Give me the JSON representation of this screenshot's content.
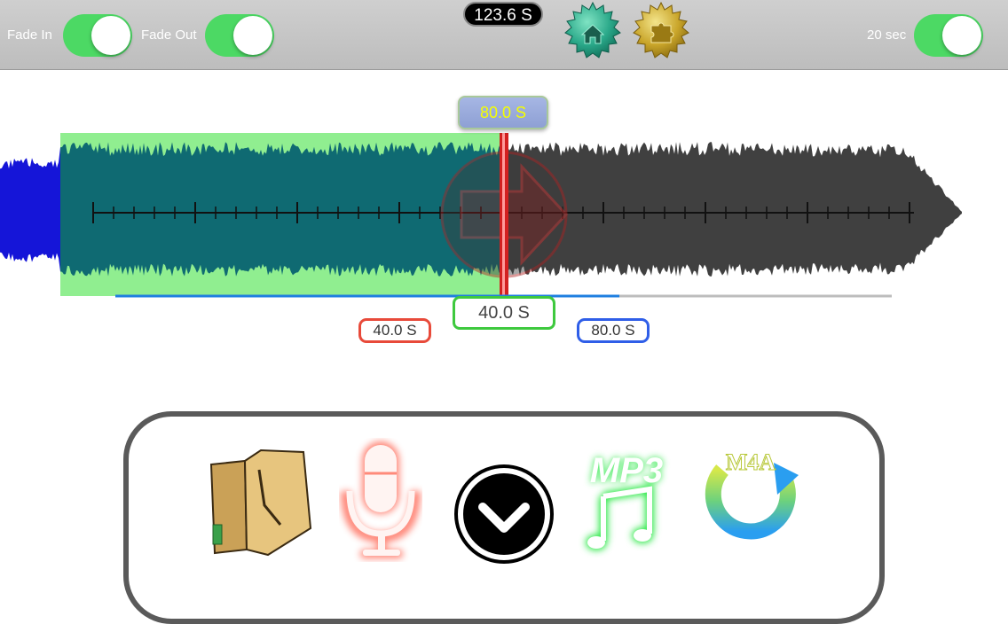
{
  "toolbar": {
    "fade_in_label": "Fade In",
    "fade_in_on": true,
    "fade_out_label": "Fade Out",
    "fade_out_on": true,
    "duration": "123.6 S",
    "home_icon": "home-badge-icon",
    "puzzle_icon": "puzzle-badge-icon",
    "sec_label": "20 sec",
    "sec_on": true
  },
  "editor": {
    "position": "80.0 S",
    "selection_length": "40.0 S",
    "selection_start": "40.0 S",
    "selection_end": "80.0 S",
    "play_icon": "play-arrow-icon"
  },
  "actions": {
    "folder_icon": "folder-icon",
    "mic_icon": "microphone-icon",
    "down_icon": "chevron-down-icon",
    "mp3_text": "MP3",
    "m4a_text": "M4A"
  },
  "colors": {
    "toggle_on": "#4cd964",
    "selection": "#90ee90",
    "playhead": "#d32020",
    "waveform_pre": "#1515d8",
    "waveform_post": "#404040"
  }
}
